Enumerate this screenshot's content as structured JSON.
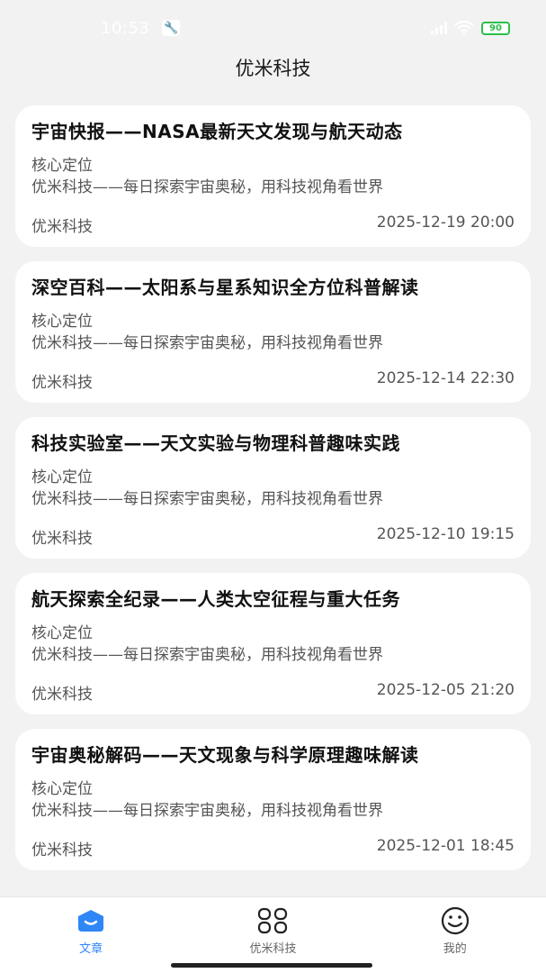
{
  "status": {
    "time": "10:53",
    "battery": "90"
  },
  "header": {
    "title": "优米科技"
  },
  "articles": [
    {
      "title": "宇宙快报——NASA最新天文发现与航天动态",
      "subtitle": "核心定位",
      "description": "优米科技——每日探索宇宙奥秘，用科技视角看世界",
      "author": "优米科技",
      "date": "2025-12-19 20:00"
    },
    {
      "title": "深空百科——太阳系与星系知识全方位科普解读",
      "subtitle": "核心定位",
      "description": "优米科技——每日探索宇宙奥秘，用科技视角看世界",
      "author": "优米科技",
      "date": "2025-12-14 22:30"
    },
    {
      "title": "科技实验室——天文实验与物理科普趣味实践",
      "subtitle": "核心定位",
      "description": "优米科技——每日探索宇宙奥秘，用科技视角看世界",
      "author": "优米科技",
      "date": "2025-12-10 19:15"
    },
    {
      "title": "航天探索全纪录——人类太空征程与重大任务",
      "subtitle": "核心定位",
      "description": "优米科技——每日探索宇宙奥秘，用科技视角看世界",
      "author": "优米科技",
      "date": "2025-12-05 21:20"
    },
    {
      "title": "宇宙奥秘解码——天文现象与科学原理趣味解读",
      "subtitle": "核心定位",
      "description": "优米科技——每日探索宇宙奥秘，用科技视角看世界",
      "author": "优米科技",
      "date": "2025-12-01 18:45"
    }
  ],
  "tabs": [
    {
      "label": "文章",
      "icon": "article-icon",
      "active": true
    },
    {
      "label": "优米科技",
      "icon": "apps-grid-icon",
      "active": false
    },
    {
      "label": "我的",
      "icon": "smiley-face-icon",
      "active": false
    }
  ],
  "colors": {
    "accent": "#2f86f6",
    "background": "#f2f2f2",
    "card": "#ffffff"
  }
}
